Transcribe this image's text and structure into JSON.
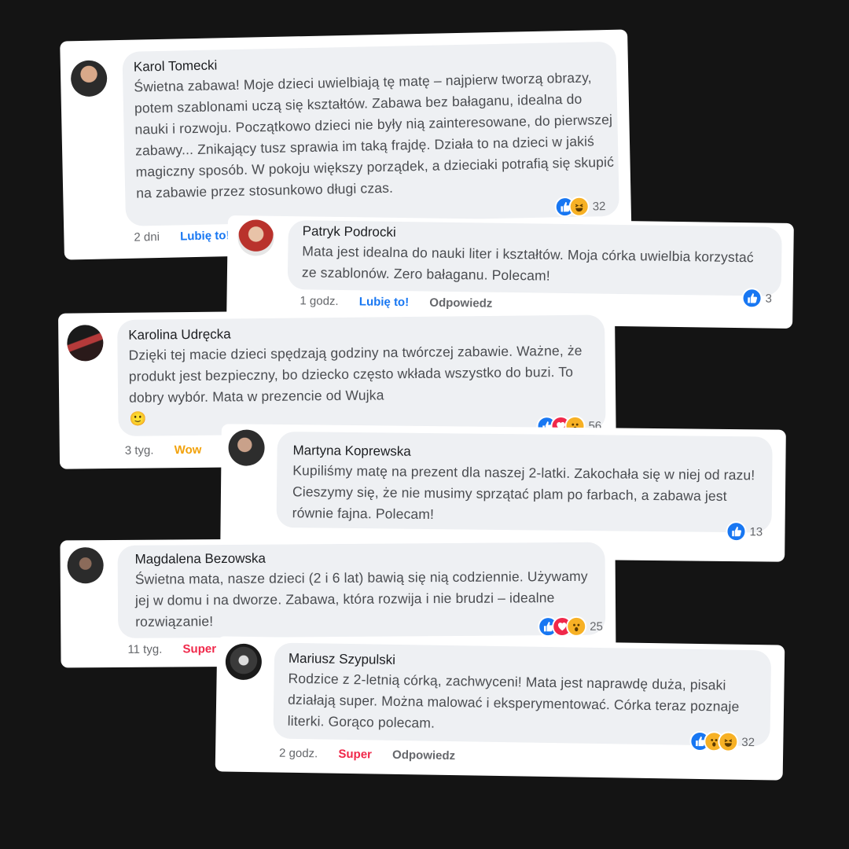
{
  "comments": [
    {
      "name": "Karol Tomecki",
      "text": "Świetna zabawa! Moje dzieci uwielbiają tę matę – najpierw tworzą obrazy, potem szablonami uczą się kształtów. Zabawa bez bałaganu, idealna do nauki i rozwoju. Początkowo dzieci nie były nią zainteresowane, do pierwszej zabawy... Znikający tusz sprawia im taką frajdę. Działa to na dzieci w jakiś magiczny sposób. W pokoju większy porządek, a dzieciaki potrafią się skupić na zabawie przez stosunkowo długi czas.",
      "time": "2 dni",
      "action": "Lubię to!",
      "reactions": [
        "like",
        "haha"
      ],
      "count": "32"
    },
    {
      "name": "Patryk Podrocki",
      "text": "Mata jest idealna do nauki liter i kształtów. Moja córka uwielbia korzystać ze szablonów. Zero bałaganu. Polecam!",
      "time": "1 godz.",
      "action": "Lubię to!",
      "reply": "Odpowiedz",
      "reactions": [
        "like"
      ],
      "count": "3"
    },
    {
      "name": "Karolina Udręcka",
      "text": "Dzięki tej macie dzieci spędzają godziny na twórczej zabawie. Ważne, że produkt jest bezpieczny, bo dziecko często wkłada wszystko do buzi. To dobry wybór. Mata w prezencie od Wujka",
      "emoji": "🙂",
      "time": "3 tyg.",
      "action": "Wow",
      "reactions": [
        "like",
        "love",
        "wow"
      ],
      "count": "56"
    },
    {
      "name": "Martyna Koprewska",
      "text": "Kupiliśmy matę na prezent dla naszej 2-latki. Zakochała się w niej od razu! Cieszymy się, że nie musimy sprzątać plam po farbach, a zabawa jest równie fajna. Polecam!",
      "reactions": [
        "like"
      ],
      "count": "13"
    },
    {
      "name": "Magdalena Bezowska",
      "text": "Świetna mata, nasze dzieci (2 i 6 lat) bawią się nią codziennie. Używamy jej w domu i na dworze. Zabawa, która rozwija i nie brudzi – idealne rozwiązanie!",
      "time": "11 tyg.",
      "action": "Super",
      "reactions": [
        "like",
        "love",
        "wow"
      ],
      "count": "25"
    },
    {
      "name": "Mariusz Szypulski",
      "text": "Rodzice z 2-letnią córką, zachwyceni! Mata jest naprawdę duża, pisaki działają super. Można malować i eksperymentować. Córka teraz poznaje literki. Gorąco polecam.",
      "time": "2 godz.",
      "action": "Super",
      "reply": "Odpowiedz",
      "reactions": [
        "like",
        "wow",
        "haha"
      ],
      "count": "32"
    }
  ],
  "colors": {
    "background": "#141414",
    "bubble": "#eef0f3",
    "like": "#1877f2",
    "love": "#f0284a",
    "wow": "#f7b125",
    "wow_text": "#f2a20c"
  }
}
